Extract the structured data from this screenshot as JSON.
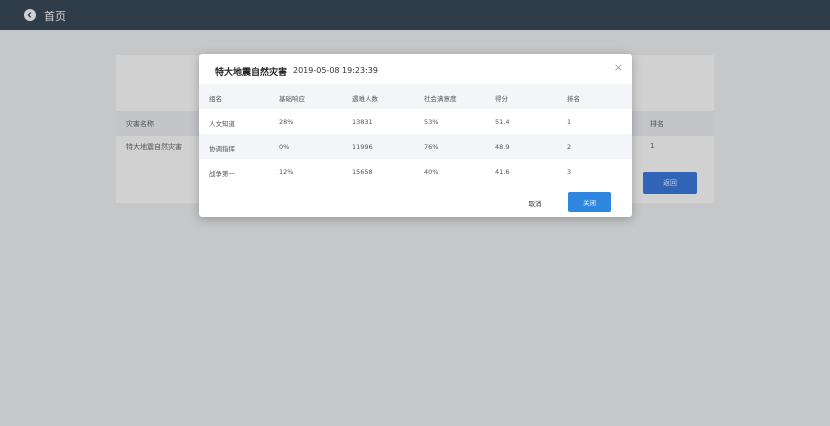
{
  "topbar": {
    "title": "首页",
    "back_icon": "arrow-left-icon"
  },
  "background": {
    "headers": [
      "灾害名称",
      "排名"
    ],
    "row": [
      "特大地震自然灾害",
      "1"
    ],
    "return_label": "返回"
  },
  "modal": {
    "title": "特大地震自然灾害",
    "datetime": "2019-05-08 19:23:39",
    "close_icon": "×",
    "headers": [
      "组名",
      "基础响应",
      "遇难人数",
      "社会满意度",
      "得分",
      "排名"
    ],
    "rows": [
      [
        "人文知道",
        "28%",
        "13831",
        "53%",
        "51.4",
        "1"
      ],
      [
        "协调指挥",
        "0%",
        "11996",
        "76%",
        "48.9",
        "2"
      ],
      [
        "战争第一",
        "12%",
        "15658",
        "40%",
        "41.6",
        "3"
      ]
    ],
    "cancel_label": "取消",
    "ok_label": "关闭"
  },
  "colors": {
    "topbar": "#3a4a5a",
    "primary": "#2e86de"
  }
}
